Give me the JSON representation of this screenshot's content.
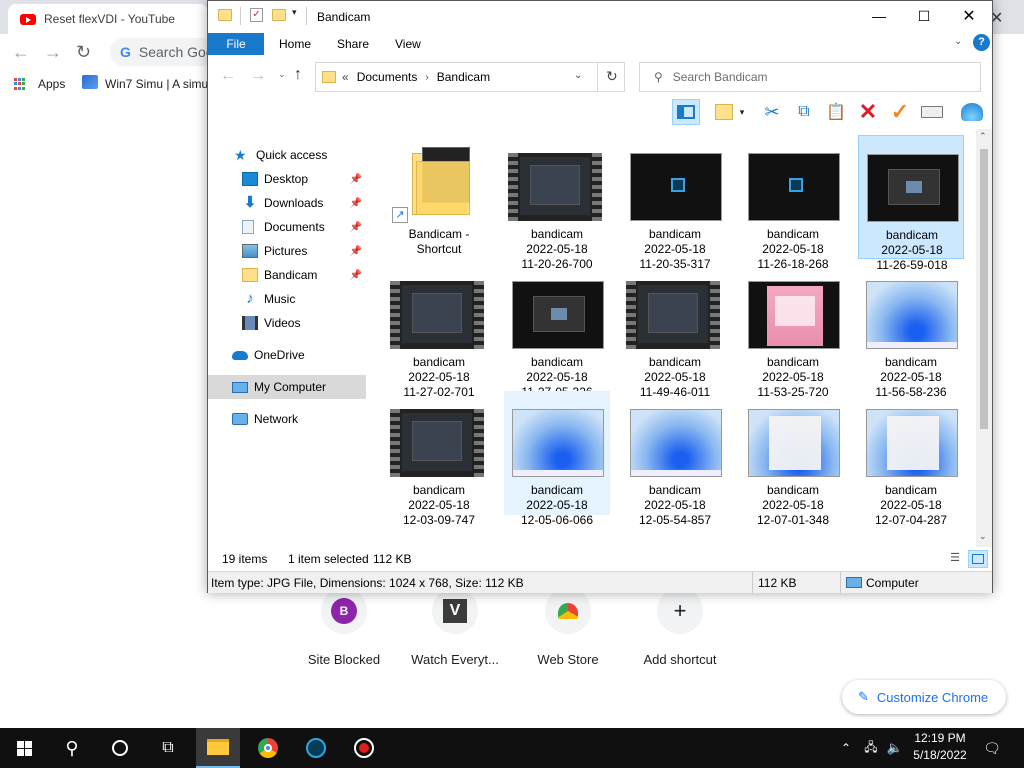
{
  "chrome": {
    "tab_title": "Reset flexVDI - YouTube",
    "omnibox_text": "Search Goo",
    "bookmarks": {
      "apps": "Apps",
      "win7": "Win7 Simu | A simu"
    },
    "shortcuts": [
      {
        "label": "Site Blocked",
        "icon": "B",
        "icon_color": "#8e24aa"
      },
      {
        "label": "Watch Everyt...",
        "icon": "V",
        "icon_color": "#3c3c3c"
      },
      {
        "label": "Web Store",
        "icon": "store-icon",
        "icon_color": "#ea4335"
      },
      {
        "label": "Add shortcut",
        "icon": "+",
        "icon_color": "#202124"
      }
    ],
    "customize_label": "Customize Chrome"
  },
  "explorer": {
    "title": "Bandicam",
    "ribbon_tabs": [
      "File",
      "Home",
      "Share",
      "View"
    ],
    "breadcrumb": {
      "prefix": "«",
      "items": [
        "Documents",
        "Bandicam"
      ]
    },
    "search_placeholder": "Search Bandicam",
    "nav": {
      "quick_access": "Quick access",
      "items": [
        {
          "label": "Desktop",
          "pinned": true
        },
        {
          "label": "Downloads",
          "pinned": true
        },
        {
          "label": "Documents",
          "pinned": true
        },
        {
          "label": "Pictures",
          "pinned": true
        },
        {
          "label": "Bandicam",
          "pinned": true
        },
        {
          "label": "Music",
          "pinned": false
        },
        {
          "label": "Videos",
          "pinned": false
        }
      ],
      "onedrive": "OneDrive",
      "my_computer": "My Computer",
      "network": "Network"
    },
    "files": [
      {
        "name": "Bandicam -",
        "line2": "Shortcut",
        "line3": "",
        "kind": "shortcut"
      },
      {
        "name": "bandicam",
        "line2": "2022-05-18",
        "line3": "11-20-26-700",
        "kind": "video"
      },
      {
        "name": "bandicam",
        "line2": "2022-05-18",
        "line3": "11-20-35-317",
        "kind": "dark"
      },
      {
        "name": "bandicam",
        "line2": "2022-05-18",
        "line3": "11-26-18-268",
        "kind": "dark"
      },
      {
        "name": "bandicam",
        "line2": "2022-05-18",
        "line3": "11-26-59-018",
        "kind": "dark-ui",
        "selected": true
      },
      {
        "name": "bandicam",
        "line2": "2022-05-18",
        "line3": "11-27-02-701",
        "kind": "video"
      },
      {
        "name": "bandicam",
        "line2": "2022-05-18",
        "line3": "11-27-05-326",
        "kind": "dark-ui"
      },
      {
        "name": "bandicam",
        "line2": "2022-05-18",
        "line3": "11-49-46-011",
        "kind": "video"
      },
      {
        "name": "bandicam",
        "line2": "2022-05-18",
        "line3": "11-53-25-720",
        "kind": "pink"
      },
      {
        "name": "bandicam",
        "line2": "2022-05-18",
        "line3": "11-56-58-236",
        "kind": "win11"
      },
      {
        "name": "bandicam",
        "line2": "2022-05-18",
        "line3": "12-03-09-747",
        "kind": "video"
      },
      {
        "name": "bandicam",
        "line2": "2022-05-18",
        "line3": "12-05-06-066",
        "kind": "win11",
        "hover": true
      },
      {
        "name": "bandicam",
        "line2": "2022-05-18",
        "line3": "12-05-54-857",
        "kind": "win11"
      },
      {
        "name": "bandicam",
        "line2": "2022-05-18",
        "line3": "12-07-01-348",
        "kind": "start"
      },
      {
        "name": "bandicam",
        "line2": "2022-05-18",
        "line3": "12-07-04-287",
        "kind": "start"
      }
    ],
    "status": {
      "count": "19 items",
      "selected": "1 item selected",
      "size": "112 KB"
    },
    "details": {
      "info": "Item type: JPG File, Dimensions: 1024 x 768, Size: 112 KB",
      "size": "112 KB",
      "location": "Computer"
    }
  },
  "taskbar": {
    "time": "12:19 PM",
    "date": "5/18/2022"
  }
}
